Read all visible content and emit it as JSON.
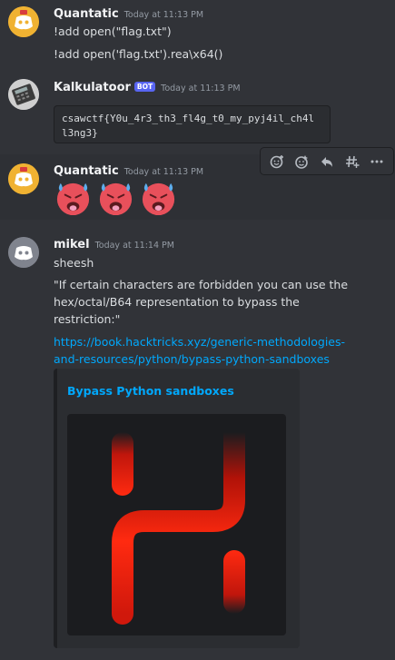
{
  "messages": [
    {
      "author": "Quantatic",
      "timestamp": "Today at 11:13 PM",
      "avatar_icon": "discord-logo-icon",
      "avatar_color": "#f0b232",
      "lines": [
        "!add open(\"flag.txt\")",
        "!add open('flag.txt').rea\\x64()"
      ]
    },
    {
      "author": "Kalkulatoor",
      "badge": "BOT",
      "timestamp": "Today at 11:13 PM",
      "avatar_icon": "calculator-icon",
      "code_lines": [
        "csawctf{Y0u_4r3_th3_fl4g_t0_my_pyj4il_ch4l",
        "l3ng3}"
      ]
    },
    {
      "author": "Quantatic",
      "timestamp": "Today at 11:13 PM",
      "avatar_icon": "discord-logo-icon",
      "avatar_color": "#f0b232",
      "emojis": [
        "hot-sweat-face-icon",
        "hot-sweat-face-icon",
        "hot-sweat-face-icon"
      ]
    },
    {
      "author": "mikel",
      "timestamp": "Today at 11:14 PM",
      "avatar_icon": "discord-logo-icon",
      "avatar_color": "#80848e",
      "text": "sheesh",
      "quote_lines": [
        "\"If certain characters are forbidden you can use the",
        "hex/octal/B64 representation to bypass the",
        "restriction:\""
      ],
      "link_lines": [
        "https://book.hacktricks.xyz/generic-methodologies-",
        "and-resources/python/bypass-python-sandboxes"
      ],
      "embed": {
        "title": "Bypass Python sandboxes",
        "image_icon": "hacktricks-logo-icon"
      }
    }
  ],
  "toolbar": [
    "add-reaction-icon",
    "super-reaction-icon",
    "reply-icon",
    "create-thread-icon",
    "more-icon"
  ],
  "colors": {
    "background": "#313338",
    "link": "#00a8fc",
    "bot_badge": "#5865f2",
    "text": "#dbdee1"
  }
}
